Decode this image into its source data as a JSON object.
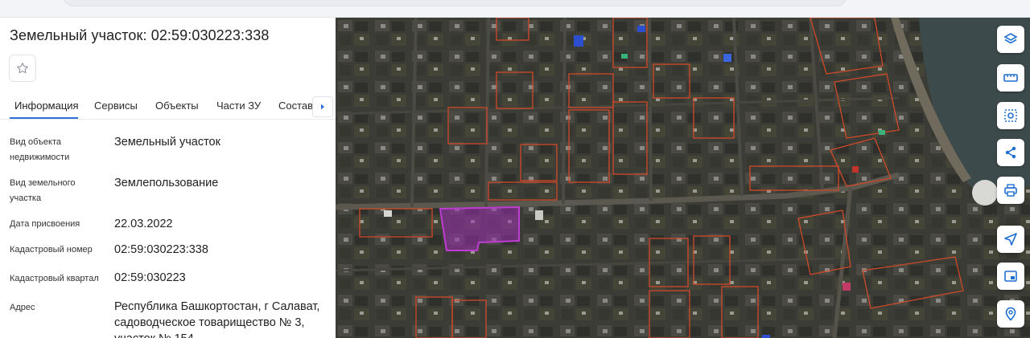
{
  "header": {
    "title": "Земельный участок: 02:59:030223:338",
    "favorite_icon": "star-outline-icon"
  },
  "tabs": [
    {
      "label": "Информация",
      "active": true
    },
    {
      "label": "Сервисы"
    },
    {
      "label": "Объекты"
    },
    {
      "label": "Части ЗУ"
    },
    {
      "label": "Состав"
    }
  ],
  "tabs_next_icon": "chevron-right-icon",
  "info": [
    {
      "label": "Вид объекта недвижимости",
      "value": "Земельный участок"
    },
    {
      "label": "Вид земельного участка",
      "value": "Землепользование"
    },
    {
      "label": "Дата присвоения",
      "value": "22.03.2022"
    },
    {
      "label": "Кадастровый номер",
      "value": "02:59:030223:338"
    },
    {
      "label": "Кадастровый квартал",
      "value": "02:59:030223"
    },
    {
      "label": "Адрес",
      "value": "Республика Башкортостан, г Салават, садоводческое товарищество № 3, участок № 154"
    }
  ],
  "map": {
    "type": "satellite",
    "parcel_border_color": "#d0492a",
    "selected_parcel_color": "#9b2fae",
    "tools": [
      {
        "name": "layers-icon"
      },
      {
        "name": "ruler-icon"
      },
      {
        "name": "area-select-icon"
      },
      {
        "name": "share-icon"
      },
      {
        "name": "print-icon"
      },
      {
        "name": "navigation-icon"
      },
      {
        "name": "picture-in-picture-icon"
      },
      {
        "name": "location-search-icon"
      }
    ]
  },
  "colors": {
    "accent": "#2f6fd6",
    "tool_icon": "#1f6fd0"
  }
}
